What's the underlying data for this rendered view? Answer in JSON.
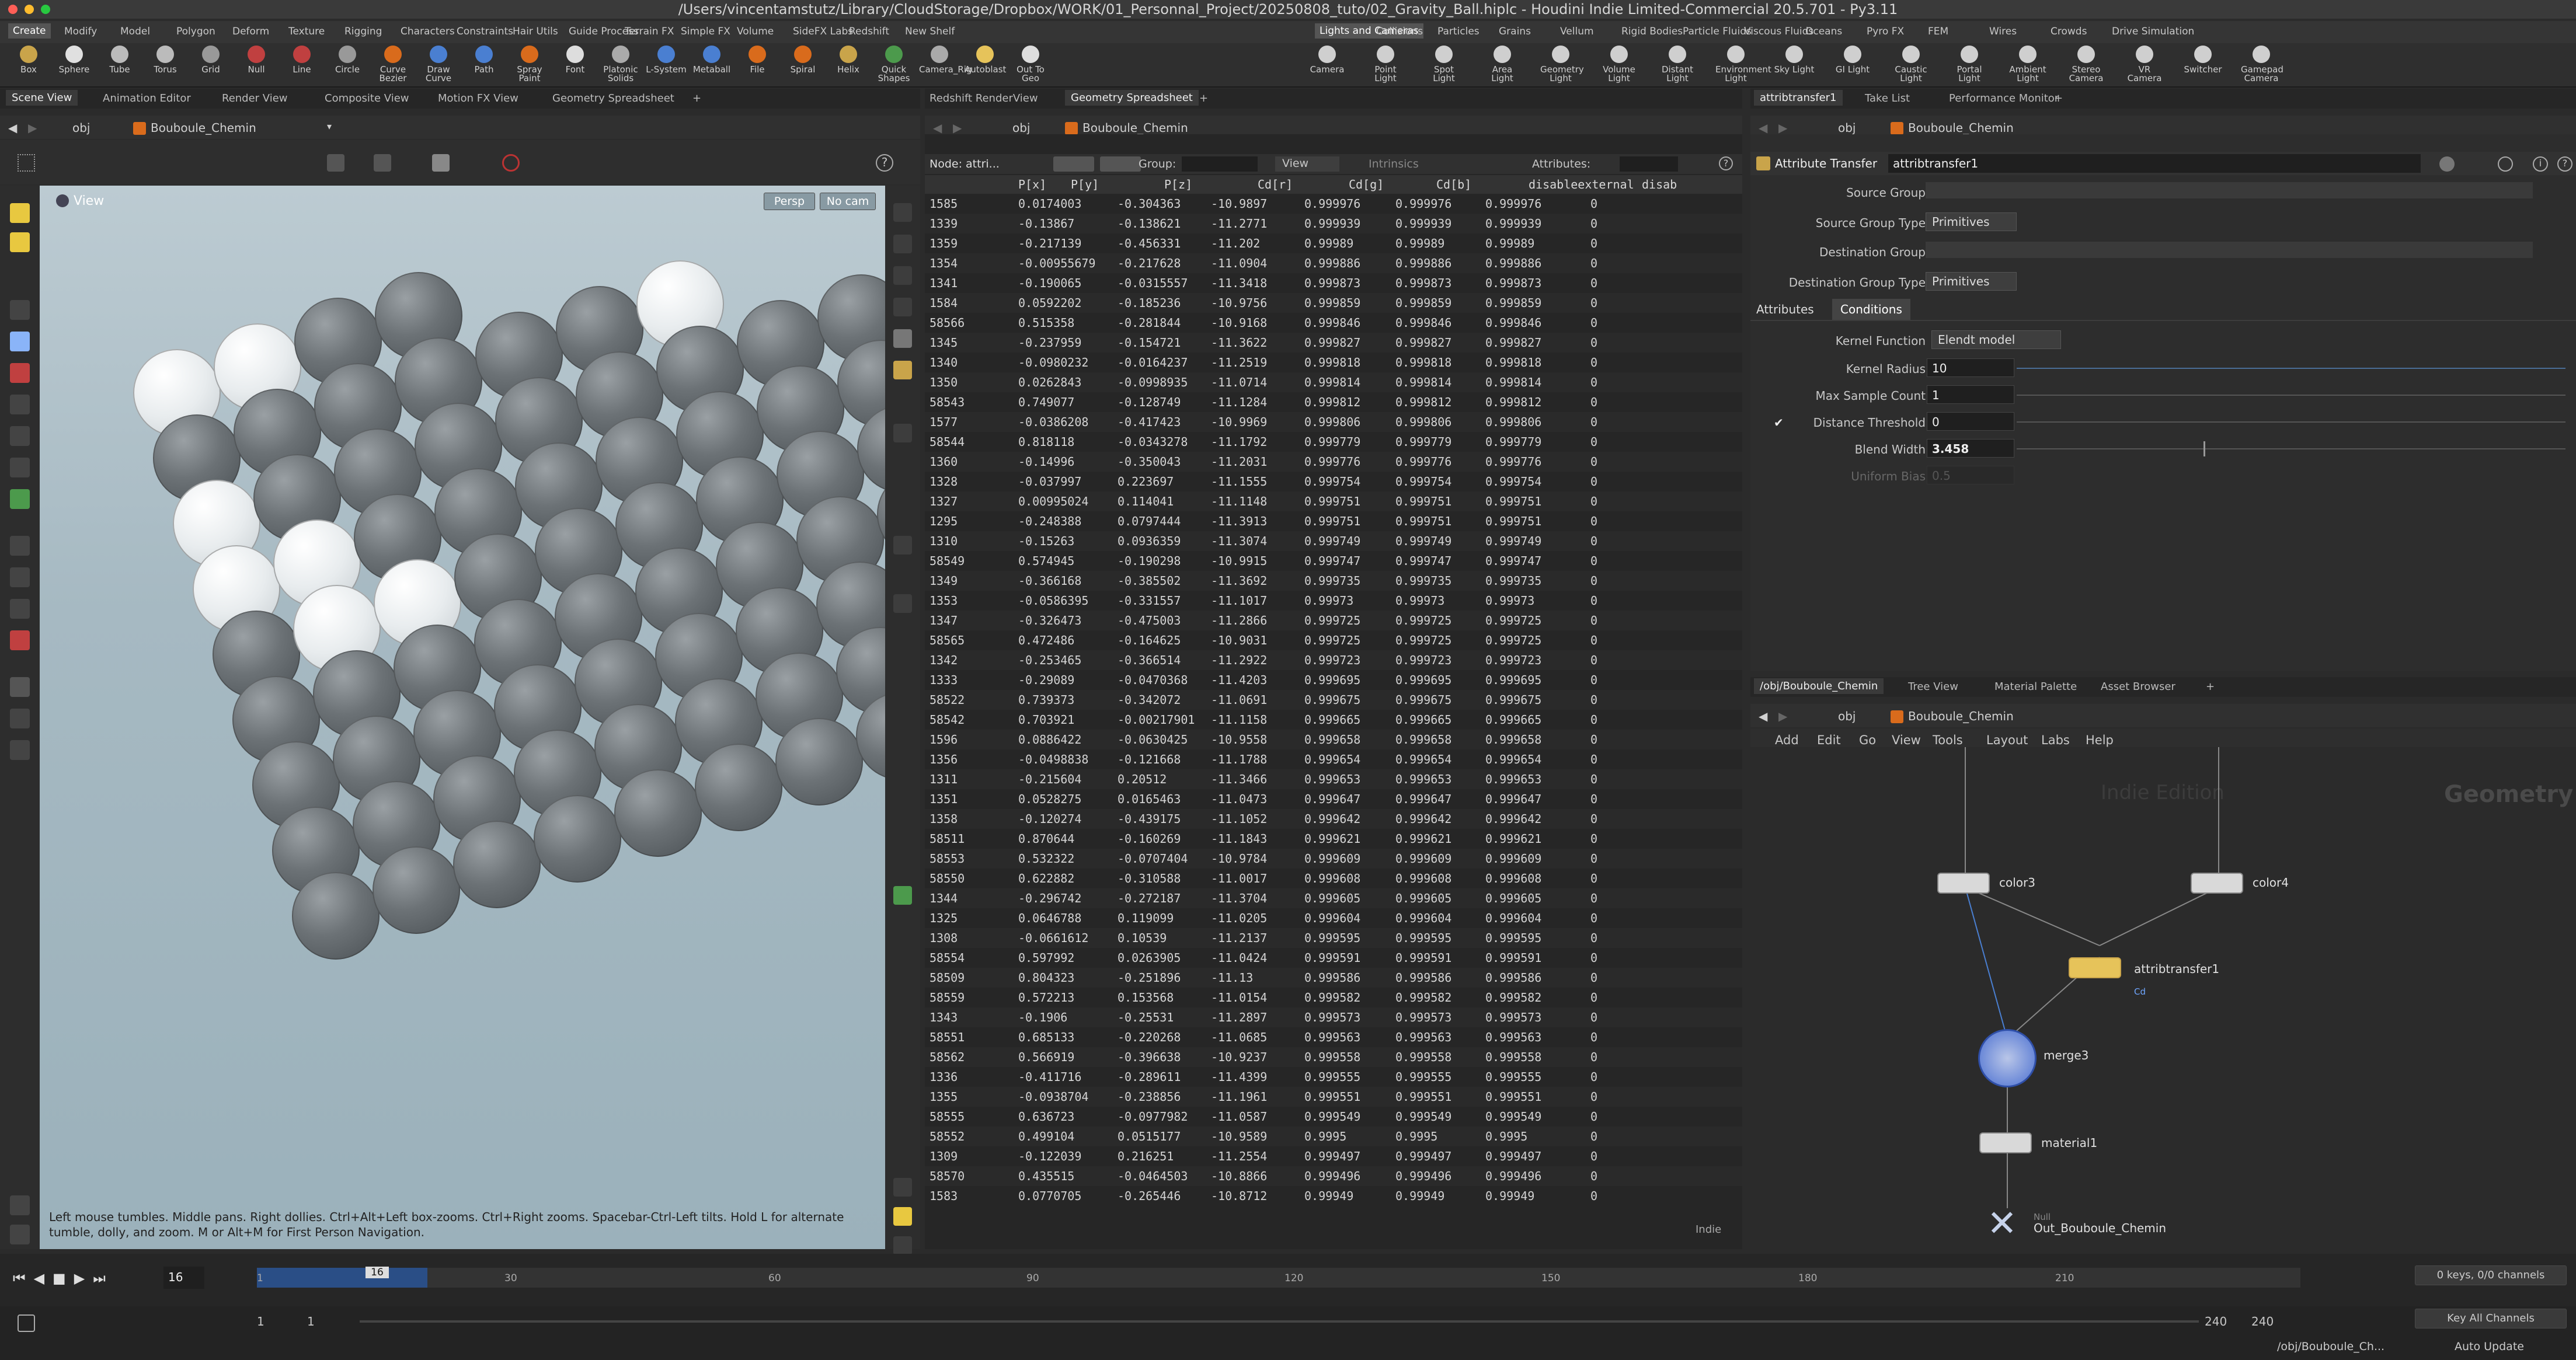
{
  "window": {
    "title": "/Users/vincentamstutz/Library/CloudStorage/Dropbox/WORK/01_Personnal_Project/20250808_tuto/02_Gravity_Ball.hiplc - Houdini Indie Limited-Commercial 20.5.701 - Py3.11"
  },
  "shelf_tabs_left": [
    "Create",
    "Modify",
    "Model",
    "Polygon",
    "Deform",
    "Texture",
    "Rigging",
    "Characters",
    "Constraints",
    "Hair Utils",
    "Guide Process",
    "Terrain FX",
    "Simple FX",
    "Volume",
    "SideFX Labs",
    "Redshift",
    "New Shelf"
  ],
  "shelf_tabs_right": [
    "Lights and Cameras",
    "Collisions",
    "Particles",
    "Grains",
    "Vellum",
    "Rigid Bodies",
    "Particle Fluids",
    "Viscous Fluids",
    "Oceans",
    "Pyro FX",
    "FEM",
    "Wires",
    "Crowds",
    "Drive Simulation"
  ],
  "tools_left": [
    "Box",
    "Sphere",
    "Tube",
    "Torus",
    "Grid",
    "Null",
    "Line",
    "Circle",
    "Curve Bezier",
    "Draw Curve",
    "Path",
    "Spray Paint",
    "Font",
    "Platonic Solids",
    "L-System",
    "Metaball",
    "File",
    "Spiral",
    "Helix",
    "Quick Shapes",
    "Camera_Rig",
    "Autoblast",
    "Out To Geo"
  ],
  "tools_right": [
    "Camera",
    "Point Light",
    "Spot Light",
    "Area Light",
    "Geometry Light",
    "Volume Light",
    "Distant Light",
    "Environment Light",
    "Sky Light",
    "GI Light",
    "Caustic Light",
    "Portal Light",
    "Ambient Light",
    "Stereo Camera",
    "VR Camera",
    "Switcher",
    "Gamepad Camera"
  ],
  "pane_tabs_left": [
    "Scene View",
    "Animation Editor",
    "Render View",
    "Composite View",
    "Motion FX View",
    "Geometry Spreadsheet"
  ],
  "pane_tabs_mid": [
    "Redshift RenderView",
    "Geometry Spreadsheet"
  ],
  "pane_tabs_right": [
    "attribtransfer1",
    "Take List",
    "Performance Monitor"
  ],
  "pane_tabs_net": [
    "/obj/Bouboule_Chemin",
    "Tree View",
    "Material Palette",
    "Asset Browser"
  ],
  "path": {
    "obj": "obj",
    "node": "Bouboule_Chemin"
  },
  "viewport": {
    "label": "View",
    "persp": "Persp",
    "cam": "No cam",
    "hint": "Left mouse tumbles. Middle pans. Right dollies. Ctrl+Alt+Left box-zooms. Ctrl+Right zooms. Spacebar-Ctrl-Left tilts. Hold L for alternate tumble, dolly, and zoom. M or Alt+M for First Person Navigation."
  },
  "spreadsheet": {
    "node_label": "Node: attri...",
    "group_label": "Group:",
    "view_label": "View",
    "intrinsics_label": "Intrinsics",
    "attributes_label": "Attributes:",
    "columns": [
      "P[x]",
      "P[y]",
      "P[z]",
      "Cd[r]",
      "Cd[g]",
      "Cd[b]",
      "disableexternal",
      "disab"
    ],
    "rows": [
      [
        "1585",
        "0.0174003",
        "-0.304363",
        "-10.9897",
        "0.999976",
        "0.999976",
        "0.999976",
        "0"
      ],
      [
        "1339",
        "-0.13867",
        "-0.138621",
        "-11.2771",
        "0.999939",
        "0.999939",
        "0.999939",
        "0"
      ],
      [
        "1359",
        "-0.217139",
        "-0.456331",
        "-11.202",
        "0.99989",
        "0.99989",
        "0.99989",
        "0"
      ],
      [
        "1354",
        "-0.00955679",
        "-0.217628",
        "-11.0904",
        "0.999886",
        "0.999886",
        "0.999886",
        "0"
      ],
      [
        "1341",
        "-0.190065",
        "-0.0315557",
        "-11.3418",
        "0.999873",
        "0.999873",
        "0.999873",
        "0"
      ],
      [
        "1584",
        "0.0592202",
        "-0.185236",
        "-10.9756",
        "0.999859",
        "0.999859",
        "0.999859",
        "0"
      ],
      [
        "58566",
        "0.515358",
        "-0.281844",
        "-10.9168",
        "0.999846",
        "0.999846",
        "0.999846",
        "0"
      ],
      [
        "1345",
        "-0.237959",
        "-0.154721",
        "-11.3622",
        "0.999827",
        "0.999827",
        "0.999827",
        "0"
      ],
      [
        "1340",
        "-0.0980232",
        "-0.0164237",
        "-11.2519",
        "0.999818",
        "0.999818",
        "0.999818",
        "0"
      ],
      [
        "1350",
        "0.0262843",
        "-0.0998935",
        "-11.0714",
        "0.999814",
        "0.999814",
        "0.999814",
        "0"
      ],
      [
        "58543",
        "0.749077",
        "-0.128749",
        "-11.1284",
        "0.999812",
        "0.999812",
        "0.999812",
        "0"
      ],
      [
        "1577",
        "-0.0386208",
        "-0.417423",
        "-10.9969",
        "0.999806",
        "0.999806",
        "0.999806",
        "0"
      ],
      [
        "58544",
        "0.818118",
        "-0.0343278",
        "-11.1792",
        "0.999779",
        "0.999779",
        "0.999779",
        "0"
      ],
      [
        "1360",
        "-0.14996",
        "-0.350043",
        "-11.2031",
        "0.999776",
        "0.999776",
        "0.999776",
        "0"
      ],
      [
        "1328",
        "-0.037997",
        "0.223697",
        "-11.1555",
        "0.999754",
        "0.999754",
        "0.999754",
        "0"
      ],
      [
        "1327",
        "0.00995024",
        "0.114041",
        "-11.1148",
        "0.999751",
        "0.999751",
        "0.999751",
        "0"
      ],
      [
        "1295",
        "-0.248388",
        "0.0797444",
        "-11.3913",
        "0.999751",
        "0.999751",
        "0.999751",
        "0"
      ],
      [
        "1310",
        "-0.15263",
        "0.0936359",
        "-11.3074",
        "0.999749",
        "0.999749",
        "0.999749",
        "0"
      ],
      [
        "58549",
        "0.574945",
        "-0.190298",
        "-10.9915",
        "0.999747",
        "0.999747",
        "0.999747",
        "0"
      ],
      [
        "1349",
        "-0.366168",
        "-0.385502",
        "-11.3692",
        "0.999735",
        "0.999735",
        "0.999735",
        "0"
      ],
      [
        "1353",
        "-0.0586395",
        "-0.331557",
        "-11.1017",
        "0.99973",
        "0.99973",
        "0.99973",
        "0"
      ],
      [
        "1347",
        "-0.326473",
        "-0.475003",
        "-11.2866",
        "0.999725",
        "0.999725",
        "0.999725",
        "0"
      ],
      [
        "58565",
        "0.472486",
        "-0.164625",
        "-10.9031",
        "0.999725",
        "0.999725",
        "0.999725",
        "0"
      ],
      [
        "1342",
        "-0.253465",
        "-0.366514",
        "-11.2922",
        "0.999723",
        "0.999723",
        "0.999723",
        "0"
      ],
      [
        "1333",
        "-0.29089",
        "-0.0470368",
        "-11.4203",
        "0.999695",
        "0.999695",
        "0.999695",
        "0"
      ],
      [
        "58522",
        "0.739373",
        "-0.342072",
        "-11.0691",
        "0.999675",
        "0.999675",
        "0.999675",
        "0"
      ],
      [
        "58542",
        "0.703921",
        "-0.00217901",
        "-11.1158",
        "0.999665",
        "0.999665",
        "0.999665",
        "0"
      ],
      [
        "1596",
        "0.0886422",
        "-0.0630425",
        "-10.9558",
        "0.999658",
        "0.999658",
        "0.999658",
        "0"
      ],
      [
        "1356",
        "-0.0498838",
        "-0.121668",
        "-11.1788",
        "0.999654",
        "0.999654",
        "0.999654",
        "0"
      ],
      [
        "1311",
        "-0.215604",
        "0.20512",
        "-11.3466",
        "0.999653",
        "0.999653",
        "0.999653",
        "0"
      ],
      [
        "1351",
        "0.0528275",
        "0.0165463",
        "-11.0473",
        "0.999647",
        "0.999647",
        "0.999647",
        "0"
      ],
      [
        "1358",
        "-0.120274",
        "-0.439175",
        "-11.1052",
        "0.999642",
        "0.999642",
        "0.999642",
        "0"
      ],
      [
        "58511",
        "0.870644",
        "-0.160269",
        "-11.1843",
        "0.999621",
        "0.999621",
        "0.999621",
        "0"
      ],
      [
        "58553",
        "0.532322",
        "-0.0707404",
        "-10.9784",
        "0.999609",
        "0.999609",
        "0.999609",
        "0"
      ],
      [
        "58550",
        "0.622882",
        "-0.310588",
        "-11.0017",
        "0.999608",
        "0.999608",
        "0.999608",
        "0"
      ],
      [
        "1344",
        "-0.296742",
        "-0.272187",
        "-11.3704",
        "0.999605",
        "0.999605",
        "0.999605",
        "0"
      ],
      [
        "1325",
        "0.0646788",
        "0.119099",
        "-11.0205",
        "0.999604",
        "0.999604",
        "0.999604",
        "0"
      ],
      [
        "1308",
        "-0.0661612",
        "0.10539",
        "-11.2137",
        "0.999595",
        "0.999595",
        "0.999595",
        "0"
      ],
      [
        "58554",
        "0.597992",
        "0.0263905",
        "-11.0424",
        "0.999591",
        "0.999591",
        "0.999591",
        "0"
      ],
      [
        "58509",
        "0.804323",
        "-0.251896",
        "-11.13",
        "0.999586",
        "0.999586",
        "0.999586",
        "0"
      ],
      [
        "58559",
        "0.572213",
        "0.153568",
        "-11.0154",
        "0.999582",
        "0.999582",
        "0.999582",
        "0"
      ],
      [
        "1343",
        "-0.1906",
        "-0.25531",
        "-11.2897",
        "0.999573",
        "0.999573",
        "0.999573",
        "0"
      ],
      [
        "58551",
        "0.685133",
        "-0.220268",
        "-11.0685",
        "0.999563",
        "0.999563",
        "0.999563",
        "0"
      ],
      [
        "58562",
        "0.566919",
        "-0.396638",
        "-10.9237",
        "0.999558",
        "0.999558",
        "0.999558",
        "0"
      ],
      [
        "1336",
        "-0.411716",
        "-0.289611",
        "-11.4399",
        "0.999555",
        "0.999555",
        "0.999555",
        "0"
      ],
      [
        "1355",
        "-0.0938704",
        "-0.238856",
        "-11.1961",
        "0.999551",
        "0.999551",
        "0.999551",
        "0"
      ],
      [
        "58555",
        "0.636723",
        "-0.0977982",
        "-11.0587",
        "0.999549",
        "0.999549",
        "0.999549",
        "0"
      ],
      [
        "58552",
        "0.499104",
        "0.0515177",
        "-10.9589",
        "0.9995",
        "0.9995",
        "0.9995",
        "0"
      ],
      [
        "1309",
        "-0.122039",
        "0.216251",
        "-11.2554",
        "0.999497",
        "0.999497",
        "0.999497",
        "0"
      ],
      [
        "58570",
        "0.435515",
        "-0.0464503",
        "-10.8866",
        "0.999496",
        "0.999496",
        "0.999496",
        "0"
      ],
      [
        "1583",
        "0.0770705",
        "-0.265446",
        "-10.8712",
        "0.99949",
        "0.99949",
        "0.99949",
        "0"
      ]
    ],
    "footer": "Indie"
  },
  "params": {
    "op_type": "Attribute Transfer",
    "op_name": "attribtransfer1",
    "source_group": "Source Group",
    "source_group_type": "Source Group Type",
    "source_group_type_val": "Primitives",
    "dest_group": "Destination Group",
    "dest_group_type": "Destination Group Type",
    "dest_group_type_val": "Primitives",
    "tab_attributes": "Attributes",
    "tab_conditions": "Conditions",
    "kernel_function": "Kernel Function",
    "kernel_function_val": "Elendt model",
    "kernel_radius": "Kernel Radius",
    "kernel_radius_val": "10",
    "max_sample": "Max Sample Count",
    "max_sample_val": "1",
    "distance_threshold": "Distance Threshold",
    "distance_threshold_val": "0",
    "blend_width": "Blend Width",
    "blend_width_val": "3.458",
    "uniform_bias": "Uniform Bias",
    "uniform_bias_val": "0.5"
  },
  "network": {
    "menus": [
      "Add",
      "Edit",
      "Go",
      "View",
      "Tools",
      "Layout",
      "Labs",
      "Help"
    ],
    "watermark": "Indie Edition",
    "context": "Geometry",
    "nodes": {
      "color3": "color3",
      "color4": "color4",
      "attribtransfer1": "attribtransfer1",
      "cd": "Cd",
      "merge3": "merge3",
      "material1": "material1",
      "null_type": "Null",
      "out": "Out_Bouboule_Chemin"
    }
  },
  "timeline": {
    "current_frame": "16",
    "ticks": [
      "1",
      "30",
      "60",
      "90",
      "120",
      "150",
      "180",
      "210"
    ],
    "start": "1",
    "start2": "1",
    "end": "240",
    "end2": "240",
    "keys": "0 keys, 0/0 channels",
    "key_all": "Key All Channels",
    "path": "/obj/Bouboule_Ch...",
    "auto_update": "Auto Update"
  }
}
